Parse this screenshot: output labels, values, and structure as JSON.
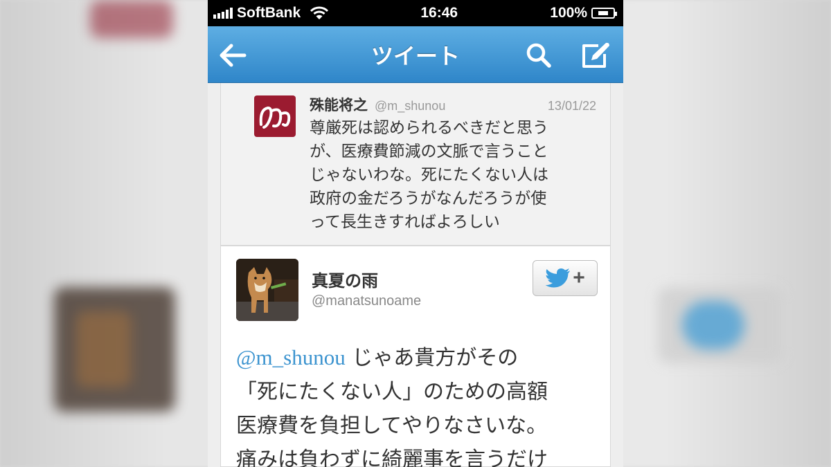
{
  "status_bar": {
    "carrier": "SoftBank",
    "time": "16:46",
    "battery": "100%"
  },
  "nav": {
    "title": "ツイート",
    "back_icon": "back-arrow-icon",
    "search_icon": "search-icon",
    "compose_icon": "compose-icon"
  },
  "quoted_tweet": {
    "name": "殊能将之",
    "handle": "@m_shunou",
    "date": "13/01/22",
    "lines": [
      "尊厳死は認められるべきだと思う",
      "が、医療費節減の文脈で言うこと",
      "じゃないわな。死にたくない人は",
      "政府の金だろうがなんだろうが使",
      "って長生きすればよろしい"
    ]
  },
  "tweet": {
    "name": "真夏の雨",
    "handle": "@manatsunoame",
    "follow_icon": "twitter-follow-icon",
    "follow_plus": "+",
    "mention": "@m_shunou",
    "line1_rest": " じゃあ貴方がその",
    "lines": [
      "「死にたくない人」のための高額",
      "医療費を負担してやりなさいな。",
      "痛みは負わずに綺麗事を言うだけ"
    ]
  },
  "colors": {
    "nav_blue": "#2f86c9",
    "mention_blue": "#3b93cf",
    "logo_red": "#9b1b30"
  }
}
